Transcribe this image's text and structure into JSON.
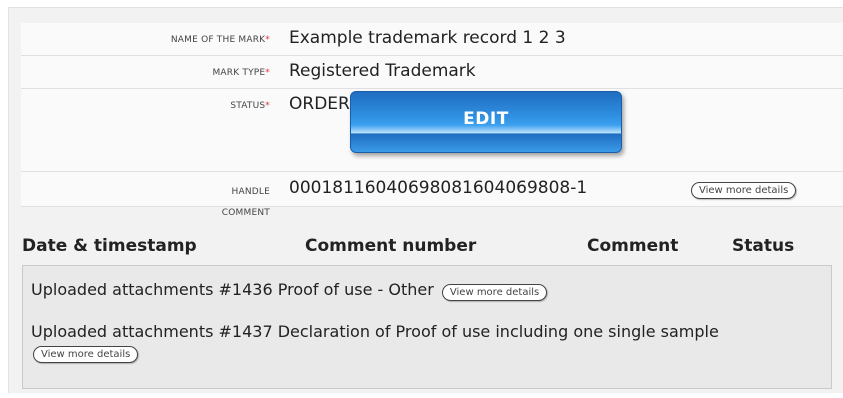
{
  "fields": {
    "name_of_mark": {
      "label": "Name of the mark",
      "value": "Example trademark record 1 2 3"
    },
    "mark_type": {
      "label": "Mark type",
      "value": "Registered Trademark"
    },
    "status": {
      "label": "Status",
      "value": "ORDER",
      "edit_label": "EDIT"
    },
    "handle": {
      "label": "Handle",
      "value": "00018116040698081604069808-1",
      "details_label": "View more details"
    },
    "comment": {
      "label": "Comment"
    }
  },
  "required_marker": "*",
  "comments_table": {
    "headers": [
      "Date & timestamp",
      "Comment number",
      "Comment",
      "Status"
    ],
    "rows": [
      {
        "text": "Uploaded attachments #1436 Proof of use - Other",
        "details_label": "View more details"
      },
      {
        "text": "Uploaded attachments #1437 Declaration of Proof of use including one single sample",
        "details_label": "View more details"
      }
    ]
  },
  "colors": {
    "edit_button": "#2f8fe0",
    "required": "#dd3333"
  }
}
